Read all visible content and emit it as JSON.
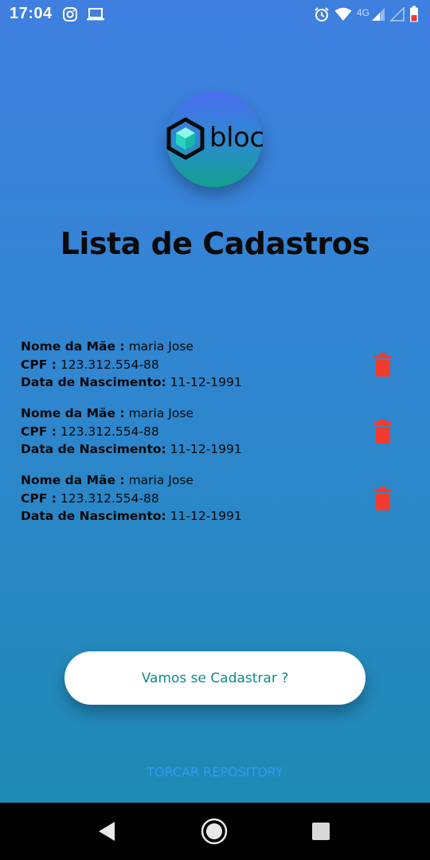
{
  "status_bar": {
    "time": "17:04",
    "network_label": "4G",
    "icons": [
      "instagram-icon",
      "laptop-icon",
      "alarm-icon",
      "wifi-icon",
      "signal-icon",
      "signal-empty-icon",
      "battery-low-icon"
    ]
  },
  "logo": {
    "text": "bloc",
    "icon": "cube-icon"
  },
  "title": "Lista de Cadastros",
  "records": [
    {
      "mother_label": "Nome da Mãe :",
      "mother_value": "maria Jose",
      "cpf_label": "CPF :",
      "cpf_value": "123.312.554-88",
      "birth_label": "Data de Nascimento:",
      "birth_value": "11-12-1991"
    },
    {
      "mother_label": "Nome da Mãe :",
      "mother_value": "maria Jose",
      "cpf_label": "CPF :",
      "cpf_value": "123.312.554-88",
      "birth_label": "Data de Nascimento:",
      "birth_value": "11-12-1991"
    },
    {
      "mother_label": "Nome da Mãe :",
      "mother_value": "maria Jose",
      "cpf_label": "CPF :",
      "cpf_value": "123.312.554-88",
      "birth_label": "Data de Nascimento:",
      "birth_value": "11-12-1991"
    }
  ],
  "cta_label": "Vamos se Cadastrar ?",
  "repo_link_label": "TORCAR REPOSITORY",
  "colors": {
    "delete": "#f23b2f",
    "cta_text": "#0e8a8a",
    "link": "#2d9cf0"
  },
  "nav": [
    "back-icon",
    "home-icon",
    "recents-icon"
  ]
}
